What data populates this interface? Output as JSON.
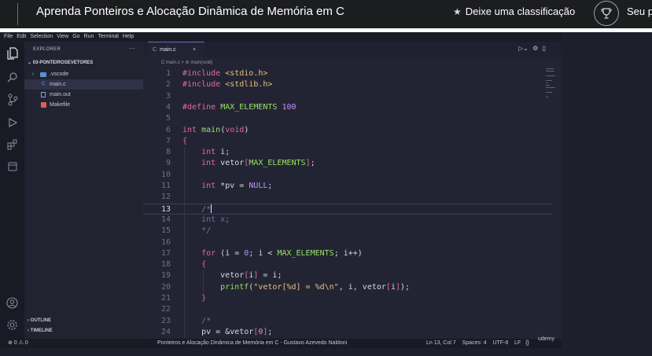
{
  "header": {
    "course_title": "Aprenda Ponteiros e Alocação Dinâmica de Memória em C",
    "rate_label": "Deixe uma classificação",
    "progress_label": "Seu p"
  },
  "vscode": {
    "menu": [
      "File",
      "Edit",
      "Selection",
      "View",
      "Go",
      "Run",
      "Terminal",
      "Help"
    ],
    "explorer": {
      "title": "EXPLORER",
      "more": "···",
      "folder": "03-PONTEIROSEVETORES",
      "items": [
        {
          "label": ".vscode",
          "kind": "folder"
        },
        {
          "label": "main.c",
          "kind": "c-file"
        },
        {
          "label": "main.out",
          "kind": "binary"
        },
        {
          "label": "Makefile",
          "kind": "makefile"
        }
      ],
      "outline": "OUTLINE",
      "timeline": "TIMELINE"
    },
    "tab": {
      "icon": "C",
      "label": "main.c",
      "close": "×"
    },
    "breadcrumb": {
      "file_icon": "C",
      "file": "main.c",
      "sep": ">",
      "symbol": "main(void)"
    },
    "code": {
      "current_line": 13,
      "lines": [
        {
          "n": "1",
          "t": "#include <stdio.h>"
        },
        {
          "n": "2",
          "t": "#include <stdlib.h>"
        },
        {
          "n": "3",
          "t": ""
        },
        {
          "n": "4",
          "t": "#define MAX_ELEMENTS 100"
        },
        {
          "n": "5",
          "t": ""
        },
        {
          "n": "6",
          "t": "int main(void)"
        },
        {
          "n": "7",
          "t": "{"
        },
        {
          "n": "8",
          "t": "    int i;"
        },
        {
          "n": "9",
          "t": "    int vetor[MAX_ELEMENTS];"
        },
        {
          "n": "10",
          "t": ""
        },
        {
          "n": "11",
          "t": "    int *pv = NULL;"
        },
        {
          "n": "12",
          "t": ""
        },
        {
          "n": "13",
          "t": "    /*"
        },
        {
          "n": "14",
          "t": "    int x;"
        },
        {
          "n": "15",
          "t": "    */"
        },
        {
          "n": "16",
          "t": ""
        },
        {
          "n": "17",
          "t": "    for (i = 0; i < MAX_ELEMENTS; i++)"
        },
        {
          "n": "18",
          "t": "    {"
        },
        {
          "n": "19",
          "t": "        vetor[i] = i;"
        },
        {
          "n": "20",
          "t": "        printf(\"vetor[%d] = %d\\n\", i, vetor[i]);"
        },
        {
          "n": "21",
          "t": "    }"
        },
        {
          "n": "22",
          "t": ""
        },
        {
          "n": "23",
          "t": "    /*"
        },
        {
          "n": "24",
          "t": "    pv = &vetor[0];"
        }
      ]
    },
    "status": {
      "errors": "⊗ 0 ⚠ 0",
      "title": "Ponteiros e Alocação Dinâmica de Memória em C - Gustavo Azevedo Naldoni",
      "position": "Ln 13, Col 7",
      "spaces": "Spaces: 4",
      "encoding": "UTF-8",
      "eol": "LF",
      "language": "{}",
      "watermark": "udemy"
    }
  }
}
